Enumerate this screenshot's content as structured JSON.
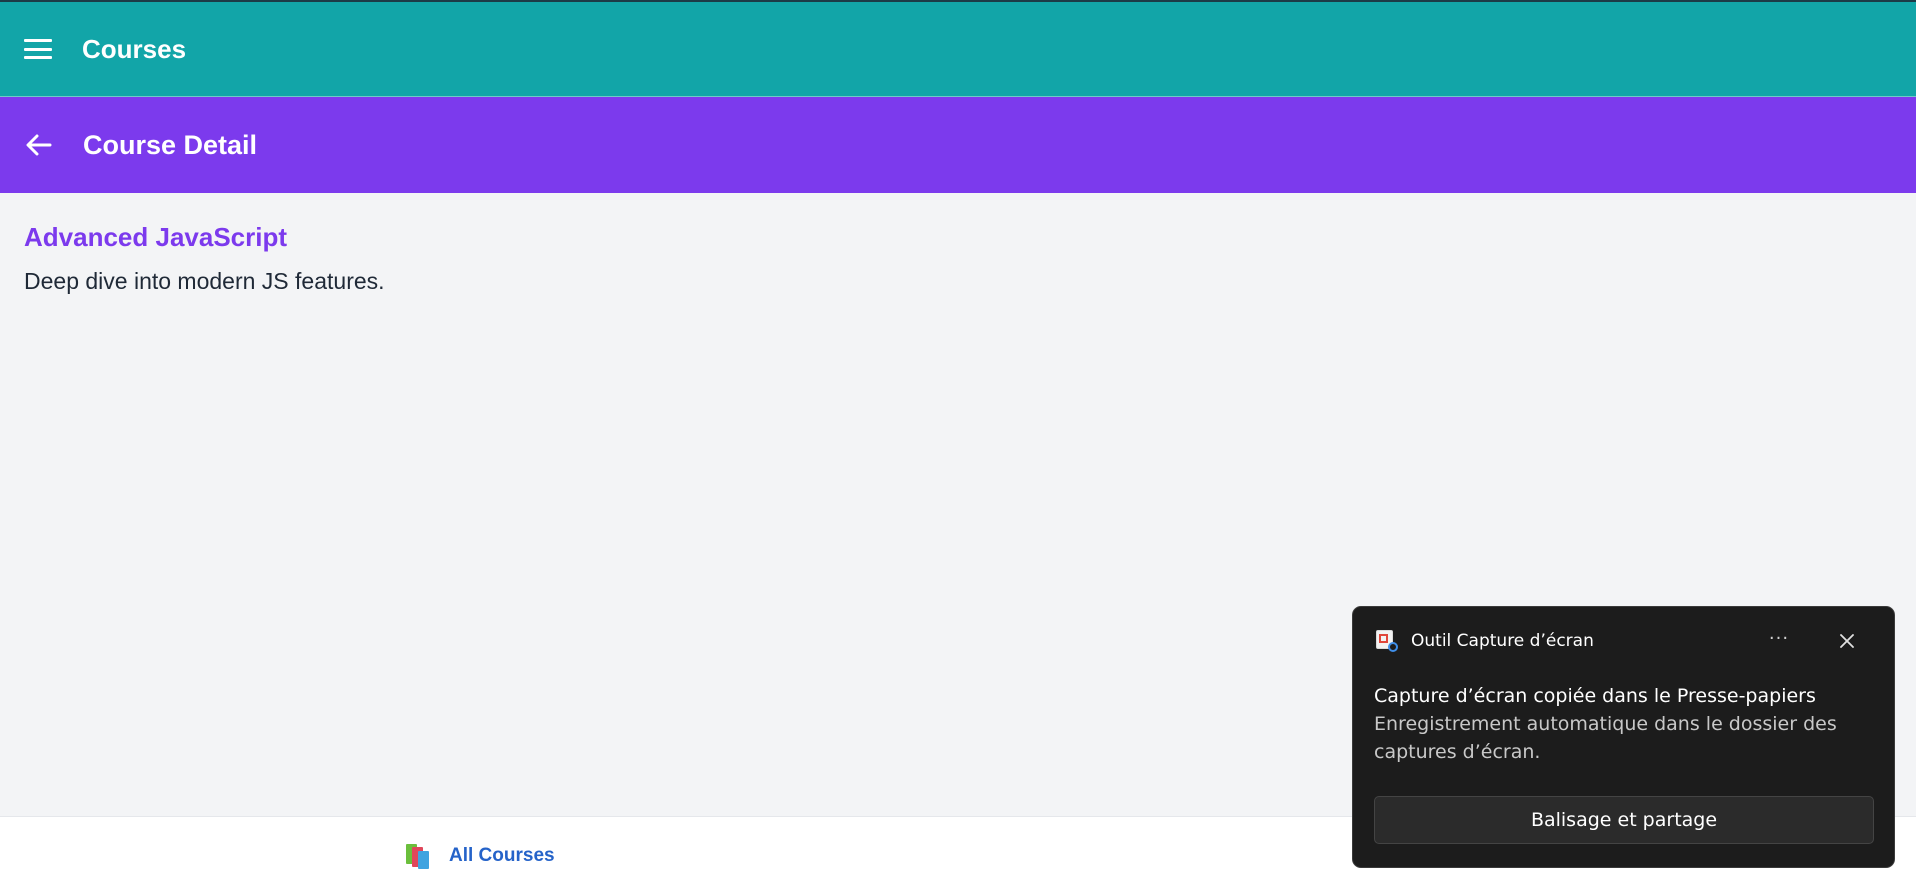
{
  "app_bar": {
    "title": "Courses",
    "menu_icon": "hamburger-menu-icon",
    "background": "#12a5a8"
  },
  "detail_bar": {
    "title": "Course Detail",
    "back_icon": "arrow-left-icon",
    "background": "#7c3aed"
  },
  "course": {
    "name": "Advanced JavaScript",
    "description": "Deep dive into modern JS features.",
    "accent": "#7c3aed"
  },
  "bottom_nav": {
    "items": [
      {
        "label": "All Courses",
        "icon": "books-icon",
        "color": "#2563c9"
      }
    ]
  },
  "toast": {
    "app_name": "Outil Capture d’écran",
    "app_icon": "snipping-tool-icon",
    "more_label": "···",
    "message": "Capture d’écran copiée dans le Presse-papiers",
    "detail": "Enregistrement automatique dans le dossier des captures d’écran.",
    "action_label": "Balisage et partage",
    "background": "#1c1c1c"
  }
}
